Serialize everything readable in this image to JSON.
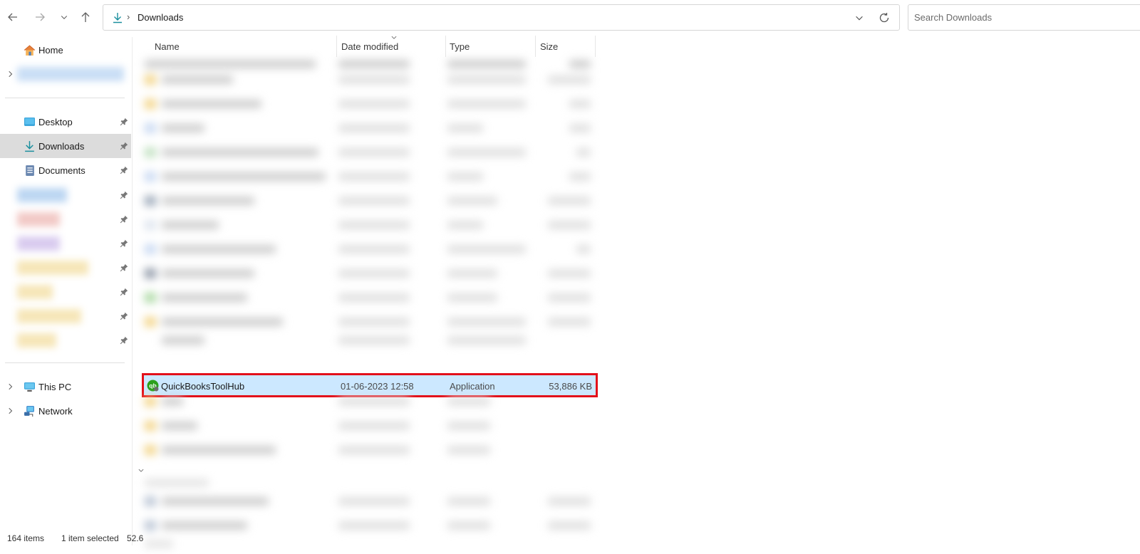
{
  "address": {
    "breadcrumb": "Downloads"
  },
  "search": {
    "placeholder": "Search Downloads"
  },
  "sidebar": {
    "home": "Home",
    "quick_access": [
      {
        "label": "Desktop",
        "icon": "desktop-icon"
      },
      {
        "label": "Downloads",
        "icon": "download-icon"
      },
      {
        "label": "Documents",
        "icon": "documents-icon"
      }
    ],
    "this_pc": "This PC",
    "network": "Network"
  },
  "columns": {
    "name": "Name",
    "date": "Date modified",
    "type": "Type",
    "size": "Size"
  },
  "selected_file": {
    "name": "QuickBooksToolHub",
    "date": "01-06-2023 12:58",
    "type": "Application",
    "size": "53,886 KB",
    "icon": "quickbooks-icon"
  },
  "status": {
    "count": "164 items",
    "selection": "1 item selected",
    "sel_size": "52.6"
  },
  "colors": {
    "selection": "#cce8ff",
    "highlight_border": "#e3101a",
    "nav_selected": "#dcdcdc",
    "accent": "#1b8f9e"
  }
}
